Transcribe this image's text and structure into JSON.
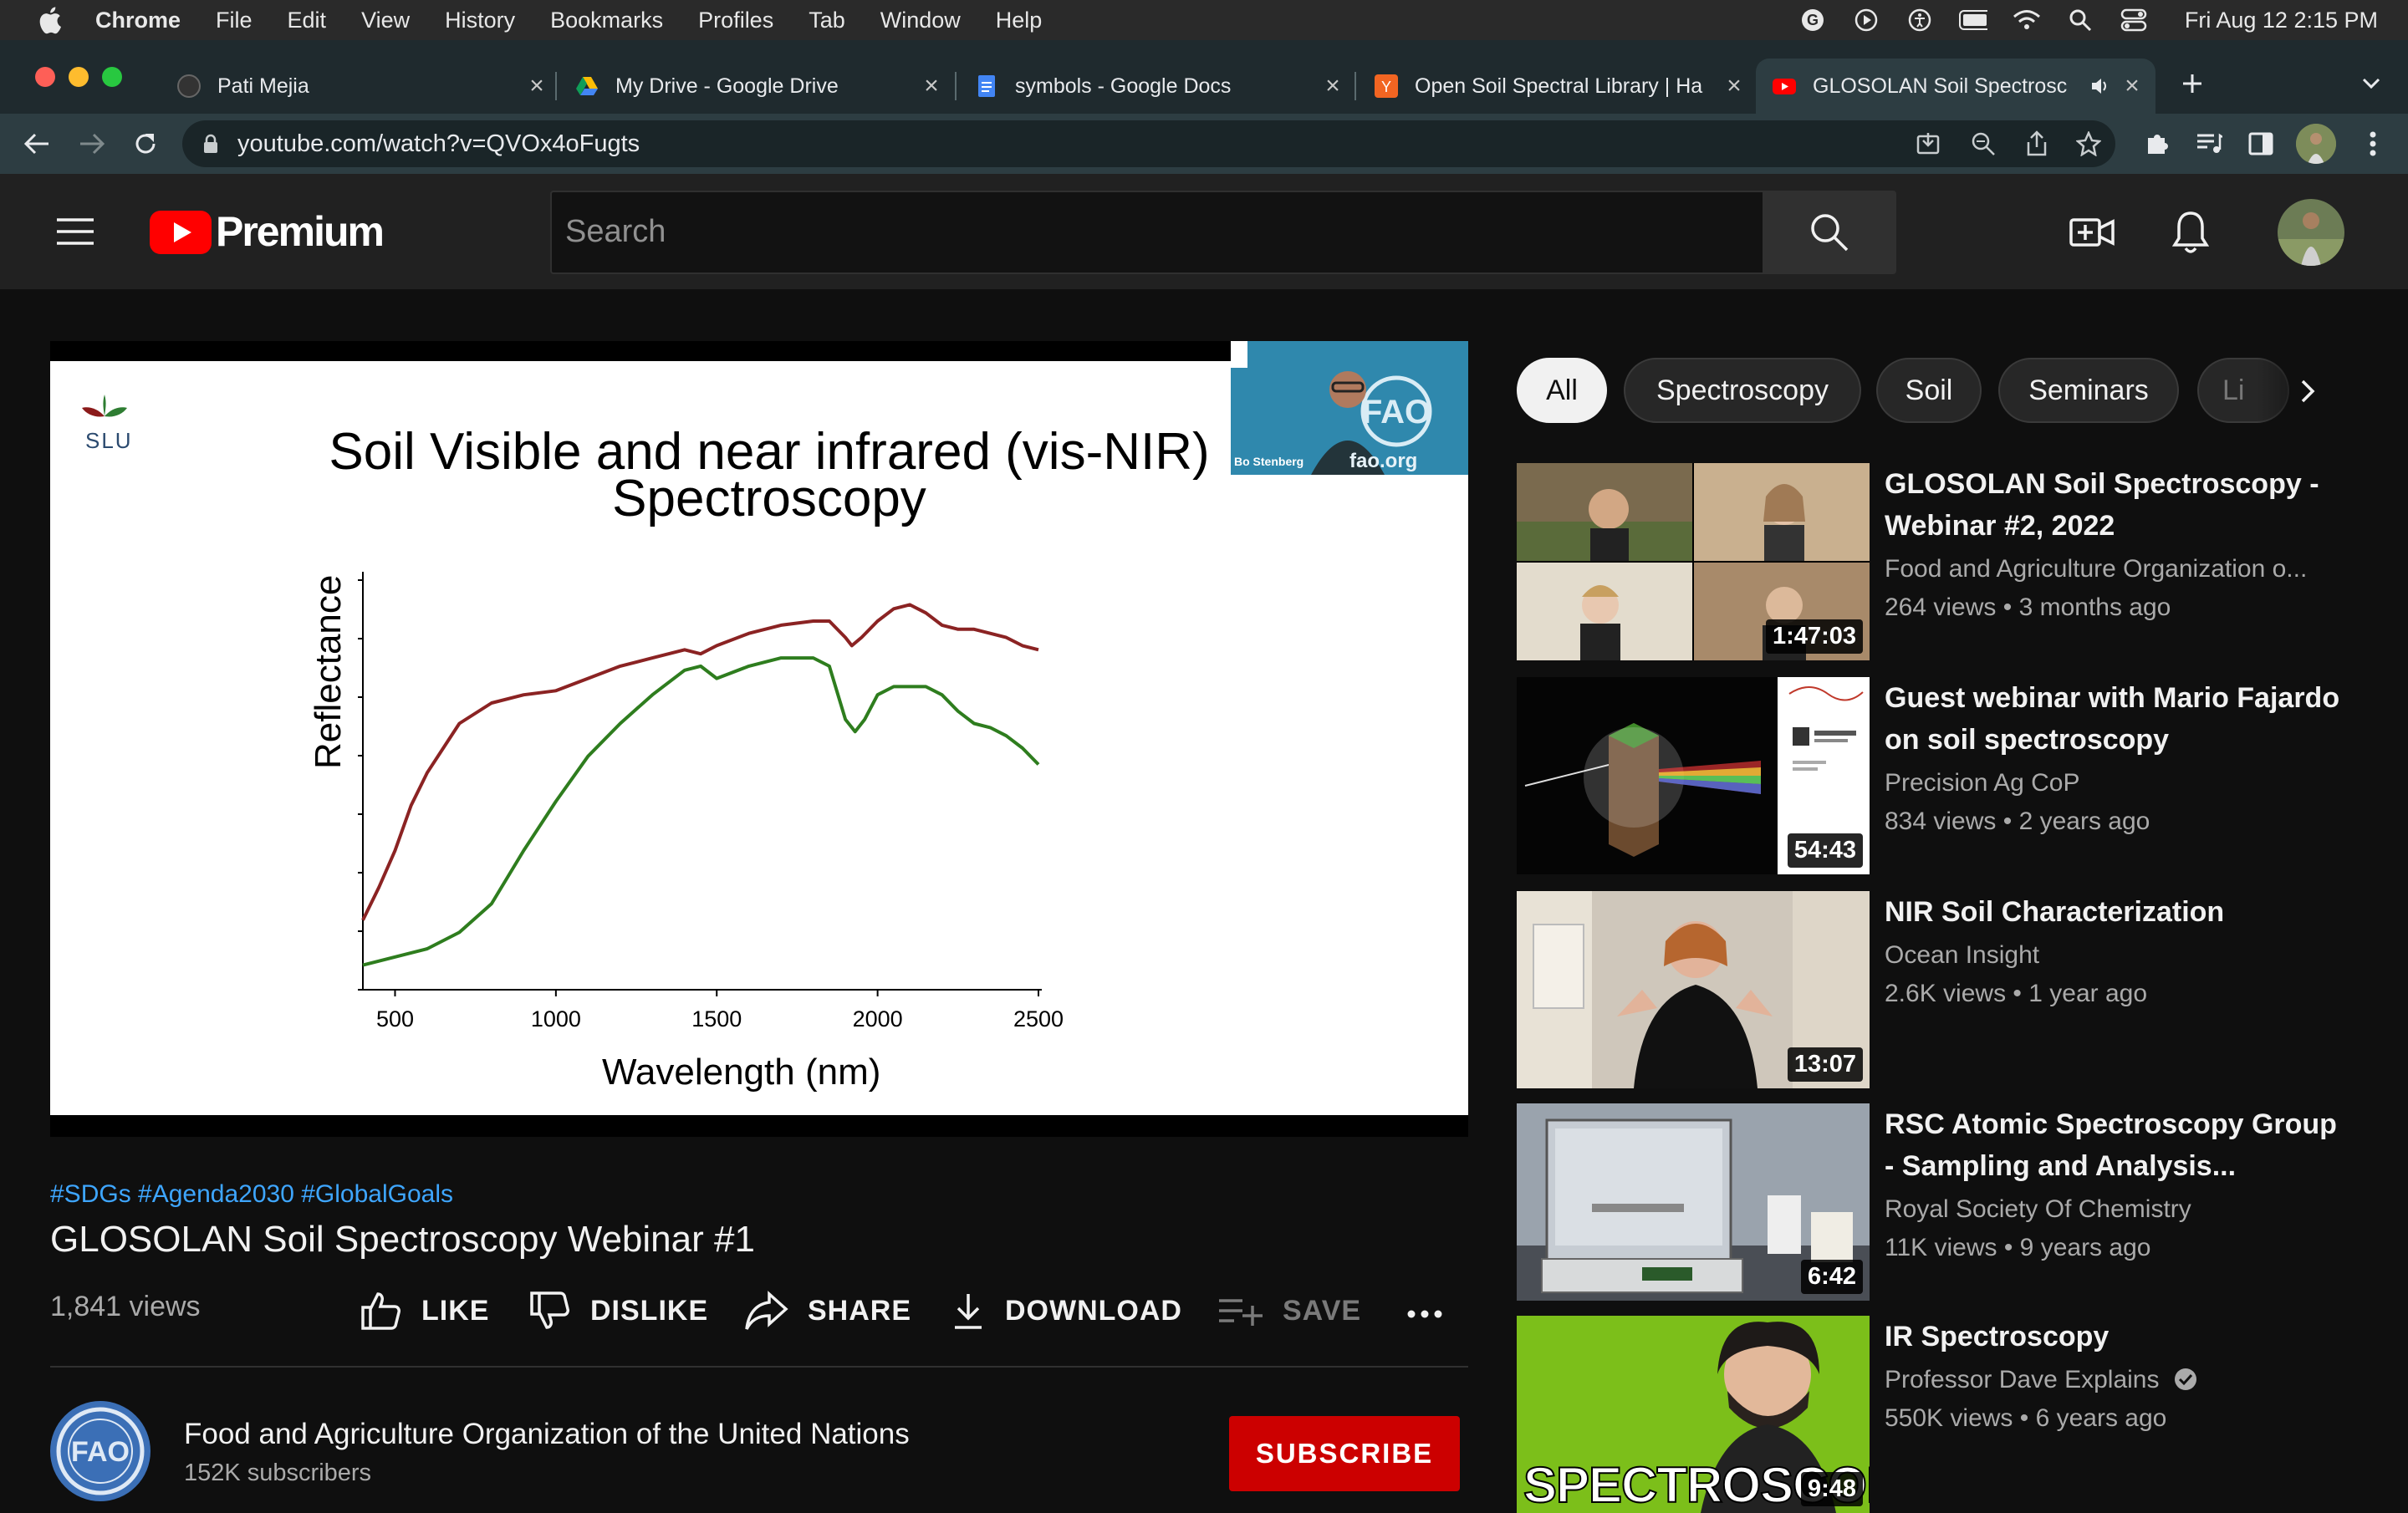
{
  "menubar": {
    "app": "Chrome",
    "items": [
      "File",
      "Edit",
      "View",
      "History",
      "Bookmarks",
      "Profiles",
      "Tab",
      "Window",
      "Help"
    ],
    "clock": "Fri Aug 12  2:15 PM"
  },
  "tabs": [
    {
      "title": "Pati Mejia"
    },
    {
      "title": "My Drive - Google Drive"
    },
    {
      "title": "symbols - Google Docs"
    },
    {
      "title": "Open Soil Spectral Library | Ha"
    },
    {
      "title": "GLOSOLAN Soil Spectrosc"
    }
  ],
  "address": {
    "url": "youtube.com/watch?v=QVOx4oFugts"
  },
  "youtube": {
    "brand": "Premium",
    "search_placeholder": "Search"
  },
  "slide": {
    "logo_text": "SLU",
    "title_line1": "Soil Visible and near infrared (vis-NIR)",
    "title_line2": "Spectroscopy",
    "cam_name": "Bo Stenberg",
    "cam_site": "fao.org"
  },
  "chart_data": {
    "type": "line",
    "xlabel": "Wavelength (nm)",
    "ylabel": "Reflectance",
    "xlim": [
      400,
      2500
    ],
    "xticks": [
      "500",
      "1000",
      "1500",
      "2000",
      "2500"
    ],
    "series": [
      {
        "color": "#8b2323",
        "x": [
          400,
          450,
          500,
          550,
          600,
          700,
          800,
          900,
          1000,
          1100,
          1200,
          1300,
          1400,
          1450,
          1500,
          1600,
          1700,
          1800,
          1850,
          1900,
          1920,
          1950,
          2000,
          2050,
          2100,
          2150,
          2200,
          2250,
          2300,
          2350,
          2400,
          2450,
          2500
        ],
        "y": [
          0.17,
          0.25,
          0.34,
          0.45,
          0.53,
          0.65,
          0.7,
          0.72,
          0.73,
          0.76,
          0.79,
          0.81,
          0.83,
          0.82,
          0.84,
          0.87,
          0.89,
          0.9,
          0.9,
          0.86,
          0.84,
          0.86,
          0.9,
          0.93,
          0.94,
          0.92,
          0.89,
          0.88,
          0.88,
          0.87,
          0.86,
          0.84,
          0.83
        ]
      },
      {
        "color": "#2e7d1e",
        "x": [
          400,
          500,
          600,
          700,
          800,
          900,
          1000,
          1100,
          1200,
          1300,
          1400,
          1450,
          1500,
          1600,
          1700,
          1800,
          1850,
          1900,
          1930,
          1960,
          2000,
          2050,
          2100,
          2150,
          2200,
          2250,
          2300,
          2350,
          2400,
          2450,
          2500
        ],
        "y": [
          0.06,
          0.08,
          0.1,
          0.14,
          0.21,
          0.34,
          0.46,
          0.57,
          0.65,
          0.72,
          0.78,
          0.79,
          0.76,
          0.79,
          0.81,
          0.81,
          0.79,
          0.66,
          0.63,
          0.66,
          0.72,
          0.74,
          0.74,
          0.74,
          0.72,
          0.68,
          0.65,
          0.64,
          0.62,
          0.59,
          0.55
        ]
      }
    ]
  },
  "video": {
    "hashtags": "#SDGs #Agenda2030 #GlobalGoals",
    "title": "GLOSOLAN Soil Spectroscopy Webinar #1",
    "views": "1,841 views",
    "actions": {
      "like": "LIKE",
      "dislike": "DISLIKE",
      "share": "SHARE",
      "download": "DOWNLOAD",
      "save": "SAVE"
    },
    "channel": "Food and Agriculture Organization of the United Nations",
    "subscribers": "152K subscribers",
    "subscribe": "SUBSCRIBE"
  },
  "chips": [
    "All",
    "Spectroscopy",
    "Soil",
    "Seminars",
    "Li"
  ],
  "recommendations": [
    {
      "title": "GLOSOLAN Soil Spectroscopy - Webinar #2, 2022",
      "channel": "Food and Agriculture Organization o...",
      "meta": "264 views • 3 months ago",
      "duration": "1:47:03"
    },
    {
      "title": "Guest webinar with Mario Fajardo on soil spectroscopy",
      "channel": "Precision Ag CoP",
      "meta": "834 views • 2 years ago",
      "duration": "54:43"
    },
    {
      "title": "NIR Soil Characterization",
      "channel": "Ocean Insight",
      "meta": "2.6K views • 1 year ago",
      "duration": "13:07"
    },
    {
      "title": "RSC Atomic Spectroscopy Group - Sampling and Analysis...",
      "channel": "Royal Society Of Chemistry",
      "meta": "11K views • 9 years ago",
      "duration": "6:42"
    },
    {
      "title": "IR Spectroscopy",
      "channel": "Professor Dave Explains",
      "meta": "550K views • 6 years ago",
      "duration": "9:48",
      "thumb_text": "SPECTROSCOPY"
    }
  ]
}
